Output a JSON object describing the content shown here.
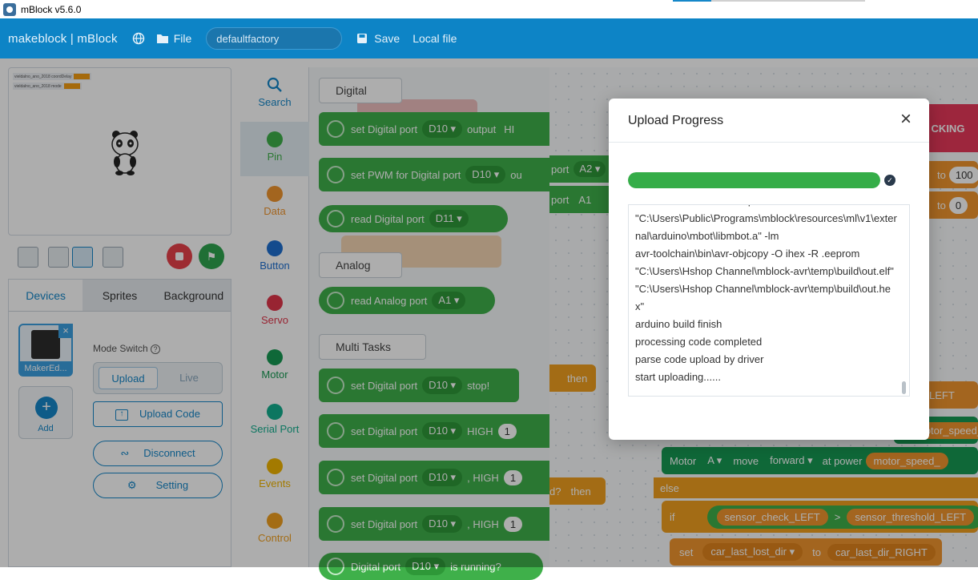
{
  "window": {
    "title": "mBlock v5.6.0"
  },
  "menubar": {
    "logo": "makeblock | mBlock",
    "file_label": "File",
    "project_name": "defaultfactory",
    "save_label": "Save",
    "local_file_label": "Local file"
  },
  "stage": {
    "variables": [
      {
        "name": "vieldalno_ano_2018 coordDelay"
      },
      {
        "name": "vieldalno_ano_2018 mode"
      }
    ]
  },
  "device_panel": {
    "tabs": [
      "Devices",
      "Sprites",
      "Background"
    ],
    "device_name": "MakerEd...",
    "add_label": "Add",
    "mode_switch_label": "Mode Switch",
    "mode_upload": "Upload",
    "mode_live": "Live",
    "upload_code": "Upload Code",
    "disconnect": "Disconnect",
    "setting": "Setting"
  },
  "categories": [
    {
      "label": "Search",
      "color": "#1587c9"
    },
    {
      "label": "Pin",
      "color": "#3fb04a"
    },
    {
      "label": "Data",
      "color": "#f0962f"
    },
    {
      "label": "Button",
      "color": "#1e6fd0"
    },
    {
      "label": "Servo",
      "color": "#e0354a"
    },
    {
      "label": "Motor",
      "color": "#179a53"
    },
    {
      "label": "Serial Port",
      "color": "#12ae8e"
    },
    {
      "label": "Events",
      "color": "#f0b400"
    },
    {
      "label": "Control",
      "color": "#f0a020"
    }
  ],
  "blocks": {
    "digital_header": "Digital",
    "analog_header": "Analog",
    "multitask_header": "Multi Tasks",
    "b1": {
      "text": "set Digital port",
      "port": "D10 ▾",
      "mid": "output",
      "tail": "HI"
    },
    "b2": {
      "text": "set PWM for Digital port",
      "port": "D10 ▾",
      "tail": "ou"
    },
    "b3": {
      "text": "read Digital port",
      "port": "D11 ▾"
    },
    "b4": {
      "text": "read Analog port",
      "port": "A1 ▾"
    },
    "b5": {
      "text": "set Digital port",
      "port": "D10 ▾",
      "tail": "stop!"
    },
    "b6": {
      "text": "set Digital port",
      "port": "D10 ▾",
      "mid": "HIGH",
      "num": "1"
    },
    "b7": {
      "text": "set Digital port",
      "port": "D10 ▾",
      "mid": ", HIGH",
      "num": "1"
    },
    "b8": {
      "text": "set Digital port",
      "port": "D10 ▾",
      "mid": ", HIGH",
      "num": "1"
    },
    "b9": {
      "text": "Digital port",
      "port": "D10 ▾",
      "tail": "is running?"
    }
  },
  "canvas": {
    "port_label": "port",
    "a2": "A2 ▾",
    "a1": "A1",
    "to": "to",
    "v100": "100",
    "v0": "0",
    "then1": "then",
    "then2": "then",
    "d_q": "d?",
    "checking": "CKING",
    "left": "LEFT",
    "motor_speed_1": "motor_speed_",
    "motor_row": {
      "motor": "Motor",
      "a": "A ▾",
      "move": "move",
      "forward": "forward ▾",
      "at_power": "at power",
      "var": "motor_speed_"
    },
    "else": "else",
    "if": "if",
    "sensor_left": "sensor_check_LEFT",
    "gt": ">",
    "threshold": "sensor_threshold_LEFT",
    "set": "set",
    "car_last": "car_last_lost_dir ▾",
    "car_to": "to",
    "dir_right": "car_last_dir_RIGHT"
  },
  "dialog": {
    "title": "Upload Progress",
    "progress": 1.0,
    "log": "Channel\\mblock-avr\\temp\\build\\code.o\n\"C:\\Users\\Public\\Programs\\mblock\\resources\\ml\\v1\\external\\arduino\\mbot\\libmbot.a\" -lm\navr-toolchain\\bin\\avr-objcopy -O ihex -R .eeprom\n\"C:\\Users\\Hshop Channel\\mblock-avr\\temp\\build\\out.elf\" \"C:\\Users\\Hshop Channel\\mblock-avr\\temp\\build\\out.hex\"\narduino build finish\nprocessing code completed\nparse code upload by driver\nstart uploading......"
  }
}
